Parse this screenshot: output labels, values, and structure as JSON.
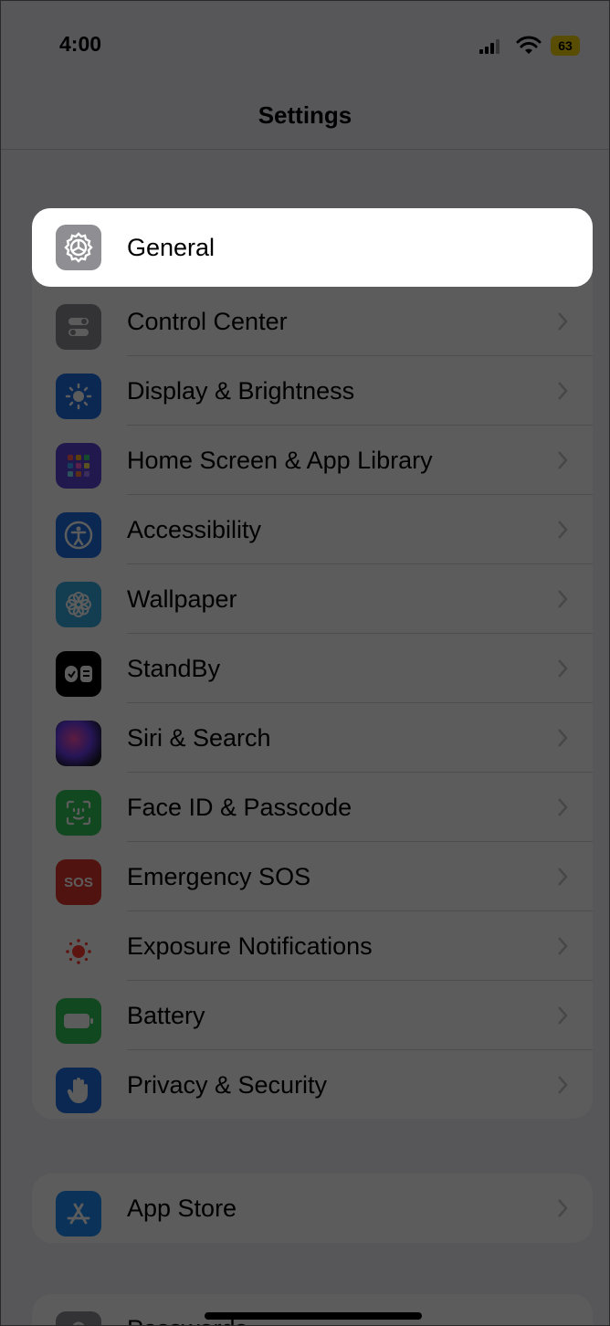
{
  "status_bar": {
    "time": "4:00",
    "battery_level": "63",
    "battery_color": "#f5d20a"
  },
  "nav": {
    "title": "Settings"
  },
  "highlighted": {
    "label": "General",
    "icon": "gear-icon",
    "color": "#8e8e93"
  },
  "group1": [
    {
      "label": "Control Center",
      "icon": "switches-icon",
      "color": "#8e8e93"
    },
    {
      "label": "Display & Brightness",
      "icon": "sun-icon",
      "color": "#1f6fe5"
    },
    {
      "label": "Home Screen & App Library",
      "icon": "app-grid-icon",
      "color": "#5b46d6"
    },
    {
      "label": "Accessibility",
      "icon": "accessibility-icon",
      "color": "#1f6fe5"
    },
    {
      "label": "Wallpaper",
      "icon": "flower-icon",
      "color": "#36a8e0"
    },
    {
      "label": "StandBy",
      "icon": "standby-icon",
      "color": "#000000"
    },
    {
      "label": "Siri & Search",
      "icon": "siri-icon",
      "color": "#1a1a2e"
    },
    {
      "label": "Face ID & Passcode",
      "icon": "face-id-icon",
      "color": "#34c759"
    },
    {
      "label": "Emergency SOS",
      "icon": "sos-icon",
      "color": "#e0352b",
      "icon_text": "SOS"
    },
    {
      "label": "Exposure Notifications",
      "icon": "exposure-icon",
      "color": "#ffffff"
    },
    {
      "label": "Battery",
      "icon": "battery-icon",
      "color": "#34c759"
    },
    {
      "label": "Privacy & Security",
      "icon": "hand-icon",
      "color": "#1f6fe5"
    }
  ],
  "group2": [
    {
      "label": "App Store",
      "icon": "app-store-icon",
      "color": "#1f8ef5"
    }
  ],
  "group3_partial": {
    "label": "Passwords",
    "icon": "key-icon",
    "color": "#8e8e93"
  }
}
